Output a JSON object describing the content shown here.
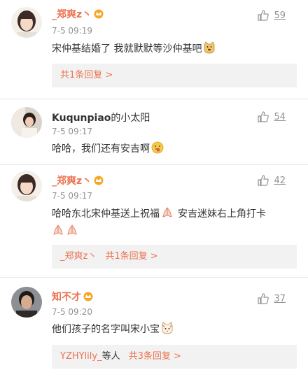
{
  "comments": [
    {
      "username": "_郑爽z丶",
      "timestamp": "7-5 09:19",
      "text": "宋仲基结婚了   我就默默等沙仲基吧",
      "likes": "59",
      "reply": {
        "prefix": "",
        "label": "共1条回复 >"
      }
    },
    {
      "username": "Kuqunpiao",
      "username_suffix": "的小太阳",
      "timestamp": "7-5 09:17",
      "text": "哈哈，我们还有安吉啊",
      "likes": "54"
    },
    {
      "username": "_郑爽z丶",
      "timestamp": "7-5 09:17",
      "text_line1_a": "哈哈东北宋仲基送上祝福",
      "text_line1_b": "安吉迷妹右上角打卡",
      "likes": "42",
      "reply": {
        "prefix": "_郑爽z丶",
        "label": "共1条回复 >"
      }
    },
    {
      "username": "知不才",
      "timestamp": "7-5 09:20",
      "text": "他们孩子的名字叫宋小宝",
      "likes": "37",
      "reply": {
        "prefix": "YZHYlily_",
        "prefix_suffix": "等人",
        "label": "共3条回复 >"
      }
    }
  ],
  "colors": {
    "link": "#eb7350",
    "muted": "#939393",
    "reply_bg": "#f2f2f2"
  },
  "icons": [
    "thumbs-up-icon",
    "vip-crown-icon",
    "doge-emoji-icon",
    "tongue-out-emoji-icon",
    "prayer-emoji-icon",
    "cat-emoji-icon"
  ]
}
